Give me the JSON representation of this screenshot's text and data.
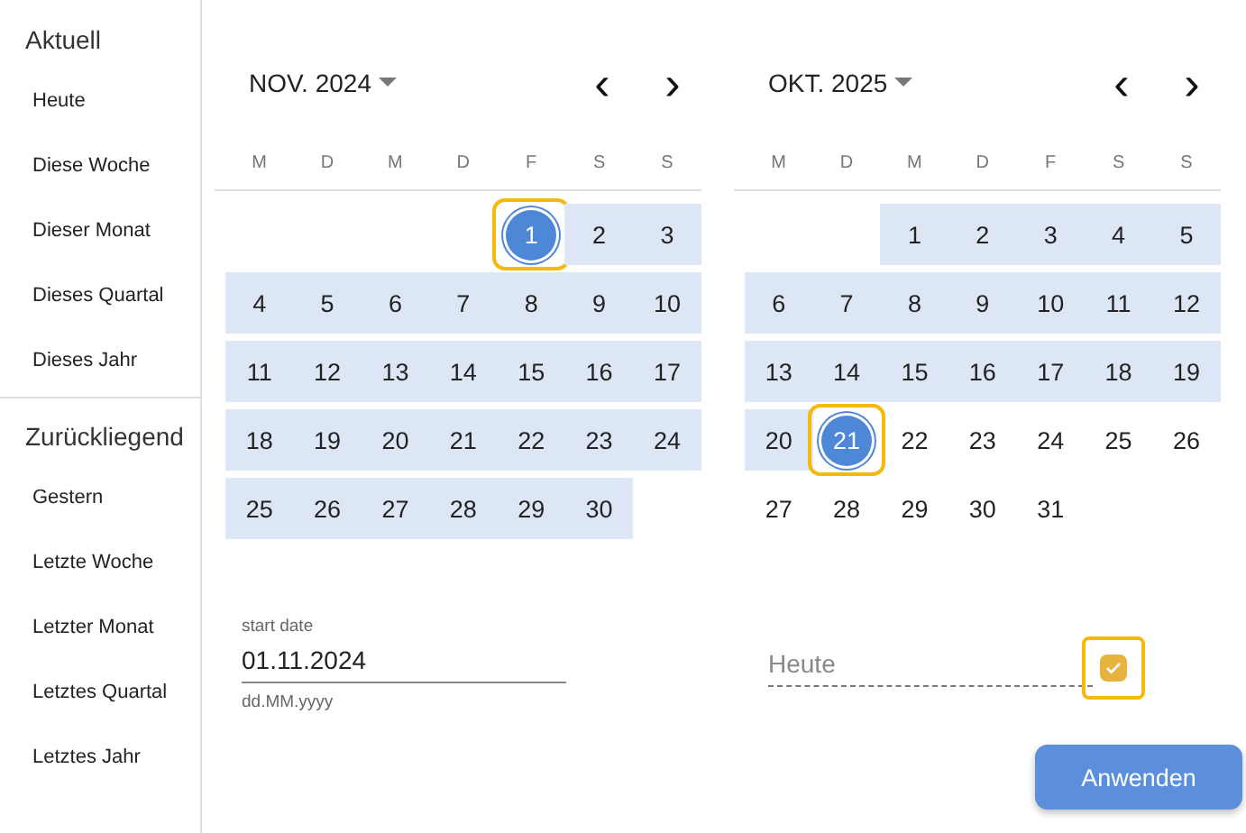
{
  "sidebar": {
    "sections": [
      {
        "title": "Aktuell",
        "items": [
          "Heute",
          "Diese Woche",
          "Dieser Monat",
          "Dieses Quartal",
          "Dieses Jahr"
        ]
      },
      {
        "title": "Zurückliegend",
        "items": [
          "Gestern",
          "Letzte Woche",
          "Letzter Monat",
          "Letztes Quartal",
          "Letztes Jahr"
        ]
      }
    ]
  },
  "calendars": [
    {
      "month": "NOV. 2024",
      "prev": "‹",
      "next": "›",
      "weekdays": [
        "M",
        "D",
        "M",
        "D",
        "F",
        "S",
        "S"
      ],
      "days": [
        {
          "kind": "blank"
        },
        {
          "kind": "blank"
        },
        {
          "kind": "blank"
        },
        {
          "kind": "blank"
        },
        {
          "kind": "day",
          "day": "1",
          "in_range": true,
          "selected": true,
          "focused": true
        },
        {
          "kind": "day",
          "day": "2",
          "in_range": true,
          "selected": false,
          "focused": false
        },
        {
          "kind": "day",
          "day": "3",
          "in_range": true,
          "selected": false,
          "focused": false
        },
        {
          "kind": "day",
          "day": "4",
          "in_range": true,
          "selected": false,
          "focused": false
        },
        {
          "kind": "day",
          "day": "5",
          "in_range": true,
          "selected": false,
          "focused": false
        },
        {
          "kind": "day",
          "day": "6",
          "in_range": true,
          "selected": false,
          "focused": false
        },
        {
          "kind": "day",
          "day": "7",
          "in_range": true,
          "selected": false,
          "focused": false
        },
        {
          "kind": "day",
          "day": "8",
          "in_range": true,
          "selected": false,
          "focused": false
        },
        {
          "kind": "day",
          "day": "9",
          "in_range": true,
          "selected": false,
          "focused": false
        },
        {
          "kind": "day",
          "day": "10",
          "in_range": true,
          "selected": false,
          "focused": false
        },
        {
          "kind": "day",
          "day": "11",
          "in_range": true,
          "selected": false,
          "focused": false
        },
        {
          "kind": "day",
          "day": "12",
          "in_range": true,
          "selected": false,
          "focused": false
        },
        {
          "kind": "day",
          "day": "13",
          "in_range": true,
          "selected": false,
          "focused": false
        },
        {
          "kind": "day",
          "day": "14",
          "in_range": true,
          "selected": false,
          "focused": false
        },
        {
          "kind": "day",
          "day": "15",
          "in_range": true,
          "selected": false,
          "focused": false
        },
        {
          "kind": "day",
          "day": "16",
          "in_range": true,
          "selected": false,
          "focused": false
        },
        {
          "kind": "day",
          "day": "17",
          "in_range": true,
          "selected": false,
          "focused": false
        },
        {
          "kind": "day",
          "day": "18",
          "in_range": true,
          "selected": false,
          "focused": false
        },
        {
          "kind": "day",
          "day": "19",
          "in_range": true,
          "selected": false,
          "focused": false
        },
        {
          "kind": "day",
          "day": "20",
          "in_range": true,
          "selected": false,
          "focused": false
        },
        {
          "kind": "day",
          "day": "21",
          "in_range": true,
          "selected": false,
          "focused": false
        },
        {
          "kind": "day",
          "day": "22",
          "in_range": true,
          "selected": false,
          "focused": false
        },
        {
          "kind": "day",
          "day": "23",
          "in_range": true,
          "selected": false,
          "focused": false
        },
        {
          "kind": "day",
          "day": "24",
          "in_range": true,
          "selected": false,
          "focused": false
        },
        {
          "kind": "day",
          "day": "25",
          "in_range": true,
          "selected": false,
          "focused": false
        },
        {
          "kind": "day",
          "day": "26",
          "in_range": true,
          "selected": false,
          "focused": false
        },
        {
          "kind": "day",
          "day": "27",
          "in_range": true,
          "selected": false,
          "focused": false
        },
        {
          "kind": "day",
          "day": "28",
          "in_range": true,
          "selected": false,
          "focused": false
        },
        {
          "kind": "day",
          "day": "29",
          "in_range": true,
          "selected": false,
          "focused": false
        },
        {
          "kind": "day",
          "day": "30",
          "in_range": true,
          "selected": false,
          "focused": false
        }
      ]
    },
    {
      "month": "OKT. 2025",
      "prev": "‹",
      "next": "›",
      "weekdays": [
        "M",
        "D",
        "M",
        "D",
        "F",
        "S",
        "S"
      ],
      "days": [
        {
          "kind": "blank"
        },
        {
          "kind": "blank"
        },
        {
          "kind": "day",
          "day": "1",
          "in_range": true,
          "selected": false,
          "focused": false
        },
        {
          "kind": "day",
          "day": "2",
          "in_range": true,
          "selected": false,
          "focused": false
        },
        {
          "kind": "day",
          "day": "3",
          "in_range": true,
          "selected": false,
          "focused": false
        },
        {
          "kind": "day",
          "day": "4",
          "in_range": true,
          "selected": false,
          "focused": false
        },
        {
          "kind": "day",
          "day": "5",
          "in_range": true,
          "selected": false,
          "focused": false
        },
        {
          "kind": "day",
          "day": "6",
          "in_range": true,
          "selected": false,
          "focused": false
        },
        {
          "kind": "day",
          "day": "7",
          "in_range": true,
          "selected": false,
          "focused": false
        },
        {
          "kind": "day",
          "day": "8",
          "in_range": true,
          "selected": false,
          "focused": false
        },
        {
          "kind": "day",
          "day": "9",
          "in_range": true,
          "selected": false,
          "focused": false
        },
        {
          "kind": "day",
          "day": "10",
          "in_range": true,
          "selected": false,
          "focused": false
        },
        {
          "kind": "day",
          "day": "11",
          "in_range": true,
          "selected": false,
          "focused": false
        },
        {
          "kind": "day",
          "day": "12",
          "in_range": true,
          "selected": false,
          "focused": false
        },
        {
          "kind": "day",
          "day": "13",
          "in_range": true,
          "selected": false,
          "focused": false
        },
        {
          "kind": "day",
          "day": "14",
          "in_range": true,
          "selected": false,
          "focused": false
        },
        {
          "kind": "day",
          "day": "15",
          "in_range": true,
          "selected": false,
          "focused": false
        },
        {
          "kind": "day",
          "day": "16",
          "in_range": true,
          "selected": false,
          "focused": false
        },
        {
          "kind": "day",
          "day": "17",
          "in_range": true,
          "selected": false,
          "focused": false
        },
        {
          "kind": "day",
          "day": "18",
          "in_range": true,
          "selected": false,
          "focused": false
        },
        {
          "kind": "day",
          "day": "19",
          "in_range": true,
          "selected": false,
          "focused": false
        },
        {
          "kind": "day",
          "day": "20",
          "in_range": true,
          "selected": false,
          "focused": false
        },
        {
          "kind": "day",
          "day": "21",
          "in_range": true,
          "selected": true,
          "focused": true
        },
        {
          "kind": "day",
          "day": "22",
          "in_range": false,
          "selected": false,
          "focused": false
        },
        {
          "kind": "day",
          "day": "23",
          "in_range": false,
          "selected": false,
          "focused": false
        },
        {
          "kind": "day",
          "day": "24",
          "in_range": false,
          "selected": false,
          "focused": false
        },
        {
          "kind": "day",
          "day": "25",
          "in_range": false,
          "selected": false,
          "focused": false
        },
        {
          "kind": "day",
          "day": "26",
          "in_range": false,
          "selected": false,
          "focused": false
        },
        {
          "kind": "day",
          "day": "27",
          "in_range": false,
          "selected": false,
          "focused": false
        },
        {
          "kind": "day",
          "day": "28",
          "in_range": false,
          "selected": false,
          "focused": false
        },
        {
          "kind": "day",
          "day": "29",
          "in_range": false,
          "selected": false,
          "focused": false
        },
        {
          "kind": "day",
          "day": "30",
          "in_range": false,
          "selected": false,
          "focused": false
        },
        {
          "kind": "day",
          "day": "31",
          "in_range": false,
          "selected": false,
          "focused": false
        }
      ]
    }
  ],
  "start_date": {
    "label": "start date",
    "value": "01.11.2024",
    "hint": "dd.MM.yyyy"
  },
  "end_date": {
    "placeholder": "Heute"
  },
  "today_checkbox": {
    "checked": true,
    "focused": true
  },
  "apply_button": "Anwenden"
}
